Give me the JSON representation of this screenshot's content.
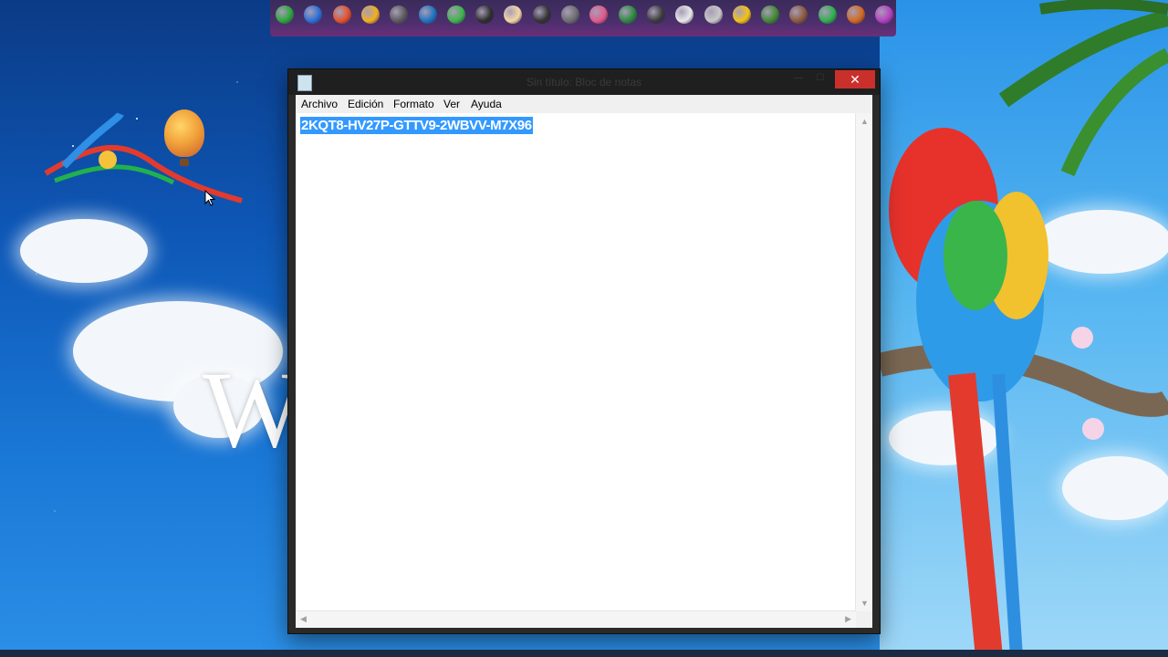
{
  "window": {
    "title": "Sin título: Bloc de notas",
    "close_glyph": "✕",
    "minimize_glyph": "—",
    "maximize_glyph": "☐"
  },
  "menu": {
    "items": [
      "Archivo",
      "Edición",
      "Formato",
      "Ver",
      "Ayuda"
    ]
  },
  "editor": {
    "content": "2KQT8-HV27P-GTTV9-2WBVV-M7X96",
    "selected": true
  },
  "desktop": {
    "wallpaper_letter": "W"
  },
  "dock": {
    "icon_colors": [
      "#2aa63a",
      "#2b6fd6",
      "#e2512a",
      "#f2b01e",
      "#5a5a5a",
      "#1e73be",
      "#3db54a",
      "#2e2e2e",
      "#f4d7a3",
      "#333333",
      "#6d6d6d",
      "#e05a8a",
      "#2b8a3e",
      "#3a3a3a",
      "#e9e9e9",
      "#c8c8c8",
      "#f2c313",
      "#3f8a2f",
      "#8a5a3a",
      "#2db04a",
      "#d2691e",
      "#b43fbf"
    ]
  },
  "colors": {
    "selection": "#3399ff",
    "close_button": "#c9302c",
    "titlebar": "#1f1f1f"
  }
}
